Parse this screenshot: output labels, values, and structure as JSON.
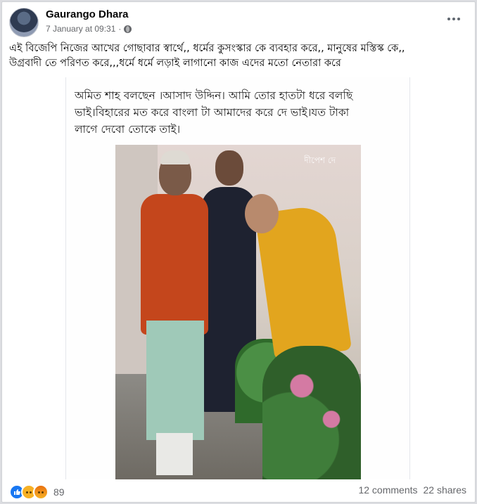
{
  "post": {
    "author": "Gaurango Dhara",
    "timestamp": "7 January at 09:31",
    "separator": "·",
    "privacy_icon": "globe-icon",
    "more_icon": "more-options-icon",
    "caption_line1": "এই বিজেপি নিজের আখের গোছাবার স্বার্থে,, ধর্মের কুসংস্কার কে ব্যবহার করে,, মানুষের মস্তিস্ক কে,,",
    "caption_line2": "উগ্রবাদী তে পরিণত করে,,,ধর্মে ধর্মে লড়াই লাগানো কাজ এদের মতো নেতারা করে"
  },
  "media": {
    "quote_line1": "অমিত শাহ  বলছেন ।আসাদ উদ্দিন। আমি তোর হাতটা ধরে বলছি",
    "quote_line2": "ভাই।বিহারের মত করে বাংলা টা আমাদের করে দে ভাই।যত টাকা",
    "quote_line3": "লাগে দেবো তোকে তাই।",
    "watermark": "দীপেশ দে"
  },
  "footer": {
    "reaction_icons": [
      "like-icon",
      "haha-icon",
      "angry-icon"
    ],
    "reaction_count": "89",
    "comments": "12 comments",
    "shares": "22 shares"
  },
  "colors": {
    "like": "#1877f2",
    "haha": "#f7b125",
    "angry": "#e9710f",
    "secondary_text": "#65676b"
  }
}
